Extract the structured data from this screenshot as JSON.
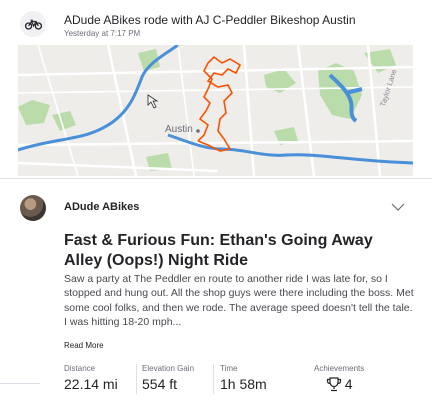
{
  "header": {
    "group_title": "ADude ABikes rode with AJ C-Peddler Bikeshop Austin",
    "timestamp": "Yesterday at 7:17 PM",
    "icon": "bike-icon"
  },
  "map": {
    "city_label": "Austin",
    "road_label": "Taylor Lane",
    "route_color": "#fc5200",
    "water_color": "#4a90d9",
    "park_color": "#b9dcaa"
  },
  "activity": {
    "athlete_name": "ADude ABikes",
    "title": "Fast & Furious Fun: Ethan's Going Away Alley (Oops!) Night Ride",
    "description": "Saw a party at The Peddler en route to another ride I was late for, so I stopped and hung out. All the shop guys were there including the boss. Met some cool folks, and then we rode. The average speed doesn't tell the tale. I was hitting 18-20 mph...",
    "read_more": "Read More",
    "more_icon": "chevron-down-icon"
  },
  "stats": {
    "distance_label": "Distance",
    "distance_value": "22.14 mi",
    "elevation_label": "Elevation Gain",
    "elevation_value": "554 ft",
    "time_label": "Time",
    "time_value": "1h 58m",
    "achievements_label": "Achievements",
    "achievements_value": "4",
    "achievements_icon": "trophy-icon"
  }
}
